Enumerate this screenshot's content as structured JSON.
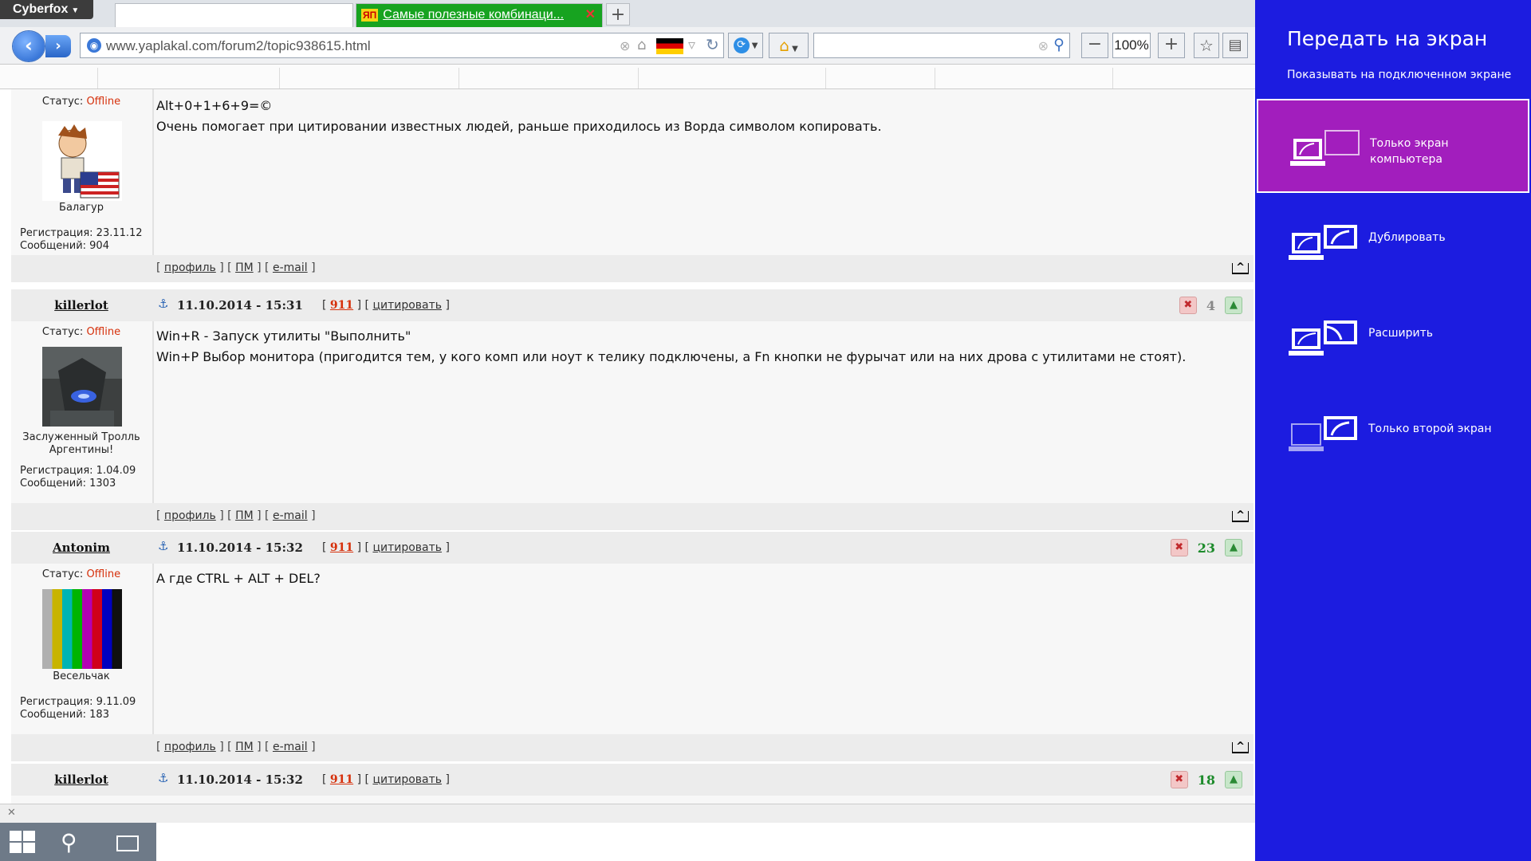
{
  "browser": {
    "app_name": "Cyberfox",
    "tabs": [
      {
        "label": ""
      },
      {
        "label": "Самые полезные комбинаци...",
        "favicon": "ЯП"
      }
    ],
    "url": "www.yaplakal.com/forum2/topic938615.html",
    "zoom": "100%"
  },
  "posts": [
    {
      "status_label": "Статус:",
      "status_value": "Offline",
      "rank": "Балагур",
      "reg": "Регистрация: 23.11.12",
      "count": "Сообщений: 904",
      "message_lines": [
        "Alt+0+1+6+9=©",
        "Очень помогает при цитировании известных людей, раньше приходилось из Ворда символом копировать."
      ],
      "footer": {
        "profile": "профиль",
        "pm": "ПМ",
        "email": "e-mail",
        "top": "^"
      }
    },
    {
      "author": "killerlot",
      "date": "11.10.2014 - 15:31",
      "num": "911",
      "quote": "цитировать",
      "score": "4",
      "status_label": "Статус:",
      "status_value": "Offline",
      "rank": "Заслуженный Тролль Аргентины!",
      "reg": "Регистрация: 1.04.09",
      "count": "Сообщений: 1303",
      "message_lines": [
        "Win+R - Запуск утилиты \"Выполнить\"",
        "Win+P Выбор монитора (пригодится тем, у кого комп или ноут к телику подключены, а Fn кнопки не фурычат или на них дрова с утилитами не стоят)."
      ],
      "footer": {
        "profile": "профиль",
        "pm": "ПМ",
        "email": "e-mail",
        "top": "^"
      }
    },
    {
      "author": "Antonim",
      "date": "11.10.2014 - 15:32",
      "num": "911",
      "quote": "цитировать",
      "score": "23",
      "status_label": "Статус:",
      "status_value": "Offline",
      "rank": "Весельчак",
      "reg": "Регистрация: 9.11.09",
      "count": "Сообщений: 183",
      "message_lines": [
        "А где CTRL + ALT + DEL?"
      ],
      "footer": {
        "profile": "профиль",
        "pm": "ПМ",
        "email": "e-mail",
        "top": "^"
      }
    },
    {
      "author": "killerlot",
      "date": "11.10.2014 - 15:32",
      "num": "911",
      "quote": "цитировать",
      "score": "18"
    }
  ],
  "project_panel": {
    "title": "Передать на экран",
    "subtitle": "Показывать на подключенном экране",
    "options": [
      {
        "label": "Только экран компьютера",
        "selected": true
      },
      {
        "label": "Дублировать",
        "selected": false
      },
      {
        "label": "Расширить",
        "selected": false
      },
      {
        "label": "Только второй экран",
        "selected": false
      }
    ],
    "accent_selected": "#a21ebd",
    "background": "#1c1ce0"
  }
}
